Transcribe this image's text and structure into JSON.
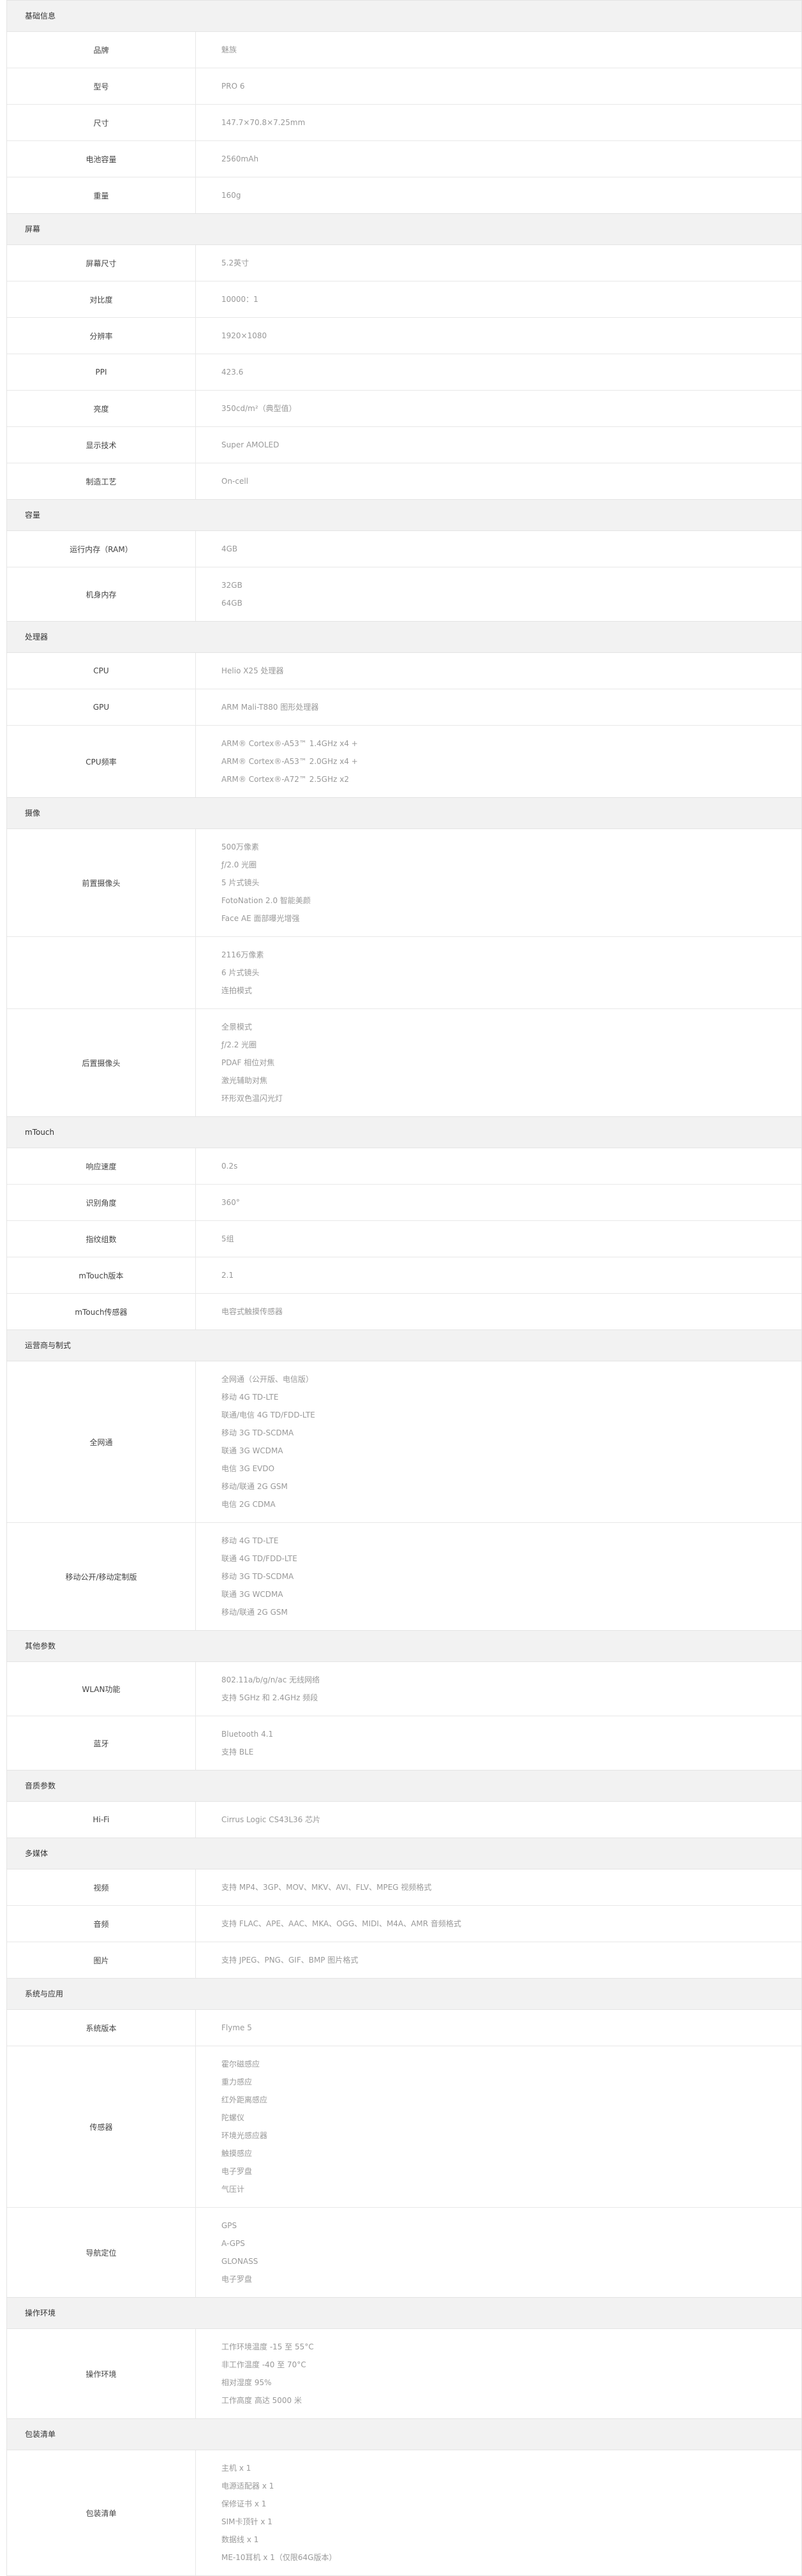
{
  "sections": [
    {
      "title": "基础信息",
      "rows": [
        {
          "label": "品牌",
          "values": [
            "魅族"
          ]
        },
        {
          "label": "型号",
          "values": [
            "PRO 6"
          ]
        },
        {
          "label": "尺寸",
          "values": [
            "147.7×70.8×7.25mm"
          ]
        },
        {
          "label": "电池容量",
          "values": [
            "2560mAh"
          ]
        },
        {
          "label": "重量",
          "values": [
            "160g"
          ]
        }
      ]
    },
    {
      "title": "屏幕",
      "rows": [
        {
          "label": "屏幕尺寸",
          "values": [
            "5.2英寸"
          ]
        },
        {
          "label": "对比度",
          "values": [
            "10000：1"
          ]
        },
        {
          "label": "分辨率",
          "values": [
            "1920×1080"
          ]
        },
        {
          "label": "PPI",
          "values": [
            "423.6"
          ]
        },
        {
          "label": "亮度",
          "values": [
            "350cd/m²（典型值）"
          ]
        },
        {
          "label": "显示技术",
          "values": [
            "Super AMOLED"
          ]
        },
        {
          "label": "制造工艺",
          "values": [
            "On-cell"
          ]
        }
      ]
    },
    {
      "title": "容量",
      "rows": [
        {
          "label": "运行内存（RAM）",
          "values": [
            "4GB"
          ]
        },
        {
          "label": "机身内存",
          "values": [
            "32GB",
            "64GB"
          ]
        }
      ]
    },
    {
      "title": "处理器",
      "rows": [
        {
          "label": "CPU",
          "values": [
            "Helio X25 处理器"
          ]
        },
        {
          "label": "GPU",
          "values": [
            "ARM Mali-T880 图形处理器"
          ]
        },
        {
          "label": "CPU频率",
          "values": [
            "ARM® Cortex®-A53™ 1.4GHz x4 +",
            "ARM® Cortex®-A53™ 2.0GHz x4 +",
            "ARM® Cortex®-A72™ 2.5GHz x2"
          ]
        }
      ]
    },
    {
      "title": "摄像",
      "rows": [
        {
          "label": "前置摄像头",
          "values": [
            "500万像素",
            "ƒ/2.0 光圈",
            "5 片式镜头",
            "FotoNation 2.0 智能美颜",
            "Face AE 面部曝光增强"
          ]
        },
        {
          "label": "",
          "values": [
            "2116万像素",
            "6 片式镜头",
            "连拍模式"
          ]
        },
        {
          "label": "后置摄像头",
          "values": [
            "全景模式",
            "ƒ/2.2 光圈",
            "PDAF 相位对焦",
            "激光辅助对焦",
            "环形双色温闪光灯"
          ]
        }
      ]
    },
    {
      "title": "mTouch",
      "rows": [
        {
          "label": "响应速度",
          "values": [
            "0.2s"
          ]
        },
        {
          "label": "识别角度",
          "values": [
            "360°"
          ]
        },
        {
          "label": "指纹组数",
          "values": [
            "5组"
          ]
        },
        {
          "label": "mTouch版本",
          "values": [
            "2.1"
          ]
        },
        {
          "label": "mTouch传感器",
          "values": [
            "电容式触摸传感器"
          ]
        }
      ]
    },
    {
      "title": "运营商与制式",
      "rows": [
        {
          "label": "全网通",
          "values": [
            "全网通（公开版、电信版）",
            "移动 4G TD-LTE",
            "联通/电信 4G TD/FDD-LTE",
            "移动 3G TD-SCDMA",
            "联通 3G WCDMA",
            "电信 3G EVDO",
            "移动/联通 2G GSM",
            "电信 2G CDMA"
          ]
        },
        {
          "label": "移动公开/移动定制版",
          "values": [
            "移动 4G TD-LTE",
            "联通 4G TD/FDD-LTE",
            "移动 3G TD-SCDMA",
            "联通 3G WCDMA",
            "移动/联通 2G GSM"
          ]
        }
      ]
    },
    {
      "title": "其他参数",
      "rows": [
        {
          "label": "WLAN功能",
          "values": [
            "802.11a/b/g/n/ac 无线网络",
            "支持 5GHz 和 2.4GHz 频段"
          ]
        },
        {
          "label": "蓝牙",
          "values": [
            "Bluetooth 4.1",
            "支持 BLE"
          ]
        }
      ]
    },
    {
      "title": "音质参数",
      "rows": [
        {
          "label": "Hi-Fi",
          "values": [
            "Cirrus Logic CS43L36 芯片"
          ]
        }
      ]
    },
    {
      "title": "多媒体",
      "rows": [
        {
          "label": "视频",
          "values": [
            "支持 MP4、3GP、MOV、MKV、AVI、FLV、MPEG 视频格式"
          ]
        },
        {
          "label": "音频",
          "values": [
            "支持 FLAC、APE、AAC、MKA、OGG、MIDI、M4A、AMR 音频格式"
          ]
        },
        {
          "label": "图片",
          "values": [
            "支持 JPEG、PNG、GIF、BMP 图片格式"
          ]
        }
      ]
    },
    {
      "title": "系统与应用",
      "rows": [
        {
          "label": "系统版本",
          "values": [
            "Flyme 5"
          ]
        },
        {
          "label": "传感器",
          "values": [
            "霍尔磁感应",
            "重力感应",
            "红外距离感应",
            "陀螺仪",
            "环境光感应器",
            "触摸感应",
            "电子罗盘",
            "气压计"
          ]
        },
        {
          "label": "导航定位",
          "values": [
            "GPS",
            "A-GPS",
            "GLONASS",
            "电子罗盘"
          ]
        }
      ]
    },
    {
      "title": "操作环境",
      "rows": [
        {
          "label": "操作环境",
          "values": [
            "工作环境温度 -15 至 55°C",
            "非工作温度 -40 至 70°C",
            "相对湿度 95%",
            "工作高度 高达 5000 米"
          ]
        }
      ]
    },
    {
      "title": "包装清单",
      "rows": [
        {
          "label": "包装清单",
          "values": [
            "主机 x 1",
            "电源适配器 x 1",
            "保修证书 x 1",
            "SIM卡顶针 x 1",
            "数据线 x 1",
            "ME-10耳机 x 1（仅限64G版本）"
          ]
        }
      ]
    }
  ]
}
